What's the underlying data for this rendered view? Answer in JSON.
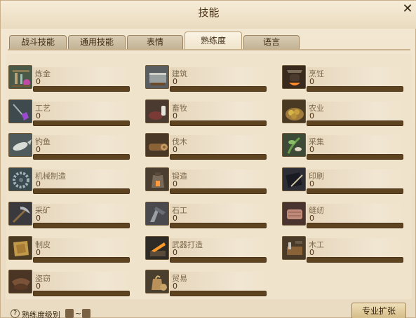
{
  "window": {
    "title": "技能",
    "close_label": "✕"
  },
  "tabs": [
    {
      "label": "战斗技能",
      "active": false
    },
    {
      "label": "通用技能",
      "active": false
    },
    {
      "label": "表情",
      "active": false
    },
    {
      "label": "熟练度",
      "active": true
    },
    {
      "label": "语言",
      "active": false
    }
  ],
  "skills": [
    {
      "name": "炼金",
      "value": "0",
      "progress": 0,
      "icon": "alchemy-icon"
    },
    {
      "name": "建筑",
      "value": "0",
      "progress": 0,
      "icon": "construction-icon"
    },
    {
      "name": "烹饪",
      "value": "0",
      "progress": 0,
      "icon": "cooking-icon"
    },
    {
      "name": "工艺",
      "value": "0",
      "progress": 0,
      "icon": "handicraft-icon"
    },
    {
      "name": "畜牧",
      "value": "0",
      "progress": 0,
      "icon": "husbandry-icon"
    },
    {
      "name": "农业",
      "value": "0",
      "progress": 0,
      "icon": "farming-icon"
    },
    {
      "name": "钓鱼",
      "value": "0",
      "progress": 0,
      "icon": "fishing-icon"
    },
    {
      "name": "伐木",
      "value": "0",
      "progress": 0,
      "icon": "logging-icon"
    },
    {
      "name": "采集",
      "value": "0",
      "progress": 0,
      "icon": "gathering-icon"
    },
    {
      "name": "机械制造",
      "value": "0",
      "progress": 0,
      "icon": "machining-icon"
    },
    {
      "name": "锻造",
      "value": "0",
      "progress": 0,
      "icon": "smithing-icon"
    },
    {
      "name": "印刷",
      "value": "0",
      "progress": 0,
      "icon": "printing-icon"
    },
    {
      "name": "采矿",
      "value": "0",
      "progress": 0,
      "icon": "mining-icon"
    },
    {
      "name": "石工",
      "value": "0",
      "progress": 0,
      "icon": "masonry-icon"
    },
    {
      "name": "缝纫",
      "value": "0",
      "progress": 0,
      "icon": "tailoring-icon"
    },
    {
      "name": "制皮",
      "value": "0",
      "progress": 0,
      "icon": "leatherwork-icon"
    },
    {
      "name": "武器打造",
      "value": "0",
      "progress": 0,
      "icon": "weaponsmith-icon"
    },
    {
      "name": "木工",
      "value": "0",
      "progress": 0,
      "icon": "carpentry-icon"
    },
    {
      "name": "盗窃",
      "value": "0",
      "progress": 0,
      "icon": "larceny-icon"
    },
    {
      "name": "贸易",
      "value": "0",
      "progress": 0,
      "icon": "commerce-icon"
    }
  ],
  "footer": {
    "help_icon": "?",
    "proficiency_level_label": "熟练度级别",
    "range_separator": "~",
    "expand_button_label": "专业扩张"
  },
  "colors": {
    "bar_track": "#5e4320",
    "panel": "#efe3cb",
    "accent": "#d4bb86"
  }
}
